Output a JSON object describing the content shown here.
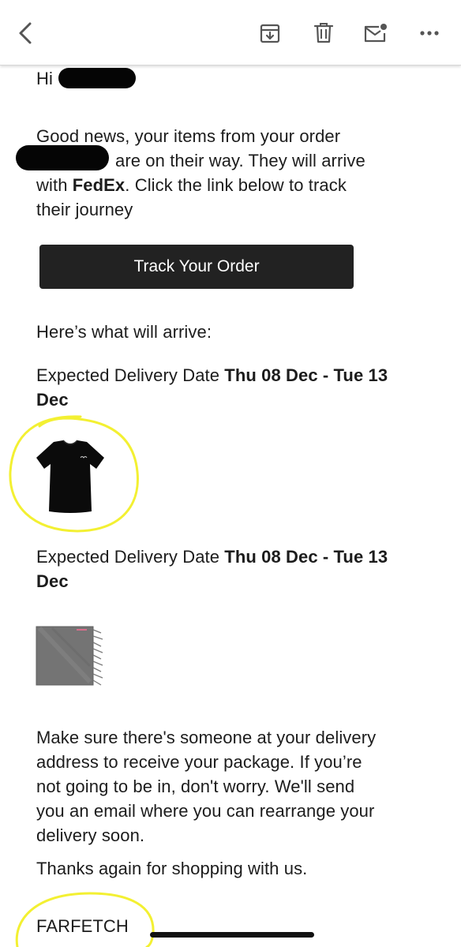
{
  "toolbar": {
    "icons": [
      "back-icon",
      "archive-icon",
      "trash-icon",
      "mark-unread-icon",
      "more-icon"
    ]
  },
  "email": {
    "greeting": "Hi",
    "intro_line1": "Good news, your items from your order",
    "intro_line2": "are on their way. They will arrive",
    "intro_line3_pre": "with ",
    "carrier": "FedEx",
    "intro_line3_post": ". Click the link below to track",
    "intro_line4": "their journey",
    "track_button": "Track Your Order",
    "arrival_heading": "Here’s what will arrive:",
    "items": [
      {
        "delivery_label": "Expected Delivery Date ",
        "delivery_range_line1": "Thu 08 Dec - Tue 13",
        "delivery_range_line2": "Dec",
        "image": "black-tshirt"
      },
      {
        "delivery_label": "Expected Delivery Date ",
        "delivery_range_line1": "Thu 08 Dec - Tue 13",
        "delivery_range_line2": "Dec",
        "image": "grey-scarf"
      }
    ],
    "closing_lines": [
      "Make sure there's someone at your delivery",
      "address to receive your package. If you’re",
      "not going to be in, don't worry. We'll send",
      "you an email where you can rearrange your",
      "delivery soon."
    ],
    "thanks": "Thanks again for shopping with us.",
    "brand": "FARFETCH"
  },
  "colors": {
    "button_bg": "#222222",
    "highlight": "#f3f032",
    "redaction": "#050505"
  }
}
